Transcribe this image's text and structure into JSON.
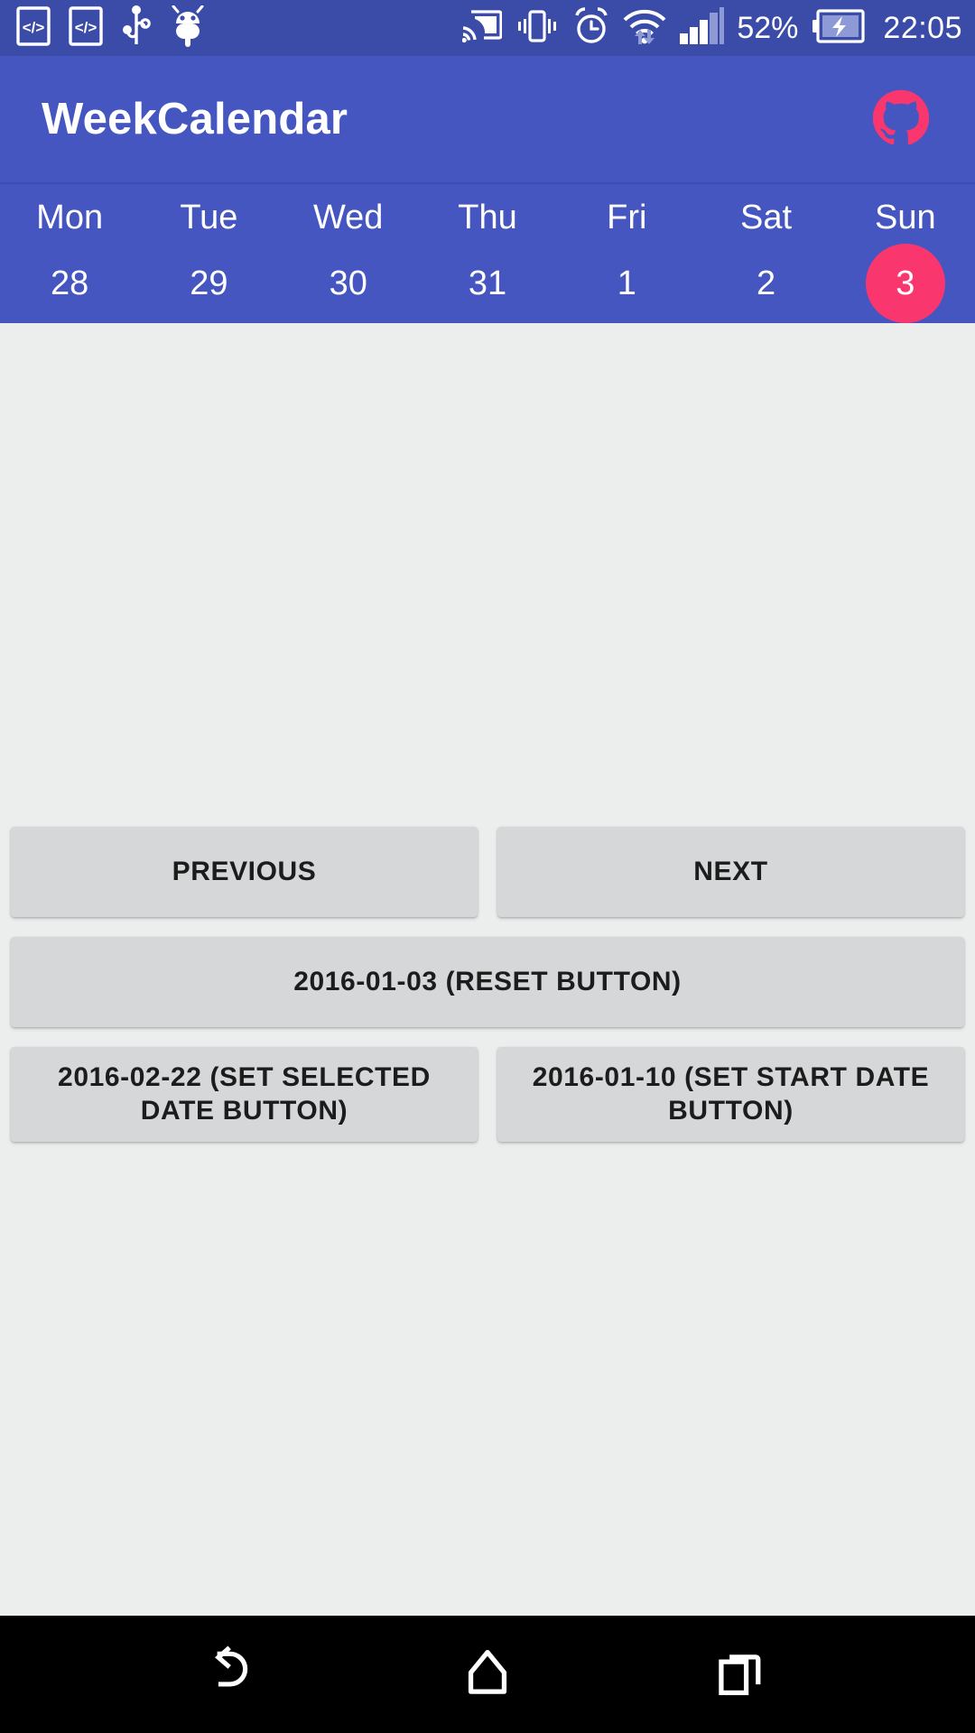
{
  "status_bar": {
    "left_icons": [
      {
        "name": "developer-code-icon-1",
        "glyph": "</>"
      },
      {
        "name": "developer-code-icon-2",
        "glyph": "</>"
      },
      {
        "name": "usb-icon",
        "glyph": "usb"
      },
      {
        "name": "android-debug-icon",
        "glyph": "android"
      }
    ],
    "right_icons": [
      {
        "name": "cast-icon",
        "glyph": "cast"
      },
      {
        "name": "vibrate-icon",
        "glyph": "vibrate"
      },
      {
        "name": "alarm-icon",
        "glyph": "alarm"
      },
      {
        "name": "wifi-icon",
        "glyph": "wifi"
      },
      {
        "name": "cellular-signal-icon",
        "glyph": "signal"
      }
    ],
    "battery_percent": "52%",
    "battery_state": "charging",
    "clock": "22:05",
    "background_color": "#3b4ba8",
    "foreground_color": "#ffffff"
  },
  "app_bar": {
    "title": "WeekCalendar",
    "background_color": "#4556c0",
    "action_icon_name": "github-octocat-icon",
    "action_icon_color": "#f9376e"
  },
  "calendar": {
    "background_color": "#4556c0",
    "selected_color": "#f9376e",
    "days": [
      {
        "dow": "Mon",
        "date": "28",
        "selected": false
      },
      {
        "dow": "Tue",
        "date": "29",
        "selected": false
      },
      {
        "dow": "Wed",
        "date": "30",
        "selected": false
      },
      {
        "dow": "Thu",
        "date": "31",
        "selected": false
      },
      {
        "dow": "Fri",
        "date": "1",
        "selected": false
      },
      {
        "dow": "Sat",
        "date": "2",
        "selected": false
      },
      {
        "dow": "Sun",
        "date": "3",
        "selected": true
      }
    ]
  },
  "buttons": {
    "previous": "PREVIOUS",
    "next": "NEXT",
    "reset": "2016-01-03 (RESET BUTTON)",
    "set_selected_date": "2016-02-22 (SET SELECTED DATE BUTTON)",
    "set_start_date": "2016-01-10 (SET START DATE BUTTON)",
    "background_color": "#d6d7d9",
    "text_color": "#1c1c1c"
  },
  "nav_bar": {
    "background_color": "#000000",
    "items": [
      {
        "name": "back-icon",
        "label": "Back"
      },
      {
        "name": "home-icon",
        "label": "Home"
      },
      {
        "name": "recents-icon",
        "label": "Recents"
      }
    ]
  }
}
